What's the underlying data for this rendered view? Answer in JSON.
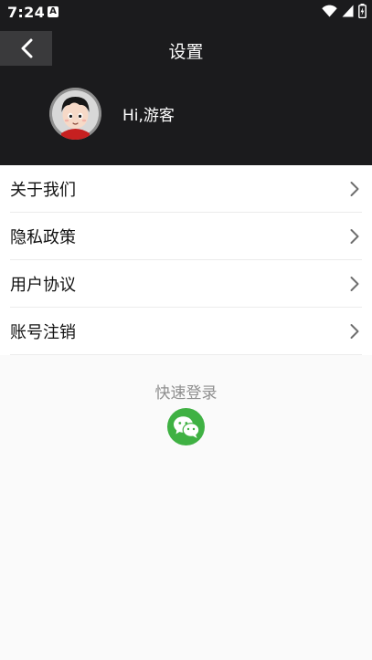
{
  "status_bar": {
    "time": "7:24",
    "notification_glyph": "A"
  },
  "header": {
    "title": "设置",
    "back_icon": "chevron-left-icon"
  },
  "profile": {
    "greeting": "Hi,游客"
  },
  "menu": {
    "items": [
      {
        "label": "关于我们"
      },
      {
        "label": "隐私政策"
      },
      {
        "label": "用户协议"
      },
      {
        "label": "账号注销"
      }
    ]
  },
  "quick_login": {
    "title": "快速登录",
    "wechat_icon": "wechat-icon"
  },
  "colors": {
    "header_bg": "#1b1b1d",
    "back_button_bg": "#3a3a3c",
    "wechat_green": "#3fb143",
    "muted_text": "#8f8f8f"
  }
}
